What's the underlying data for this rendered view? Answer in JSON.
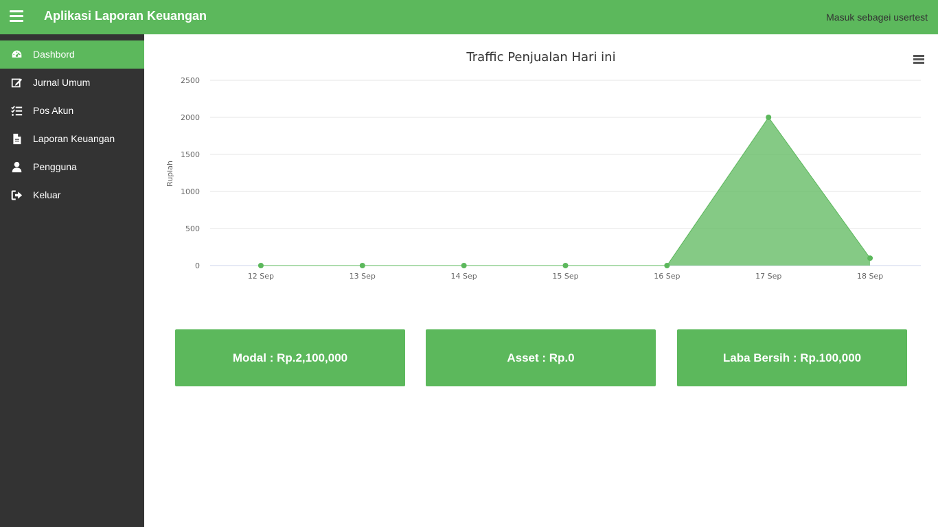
{
  "header": {
    "title": "Aplikasi Laporan Keuangan",
    "user_info": "Masuk sebagei usertest"
  },
  "sidebar": {
    "items": [
      {
        "label": "Dashbord",
        "icon": "dashboard-icon",
        "active": true
      },
      {
        "label": "Jurnal Umum",
        "icon": "edit-icon",
        "active": false
      },
      {
        "label": "Pos Akun",
        "icon": "tasks-icon",
        "active": false
      },
      {
        "label": "Laporan Keuangan",
        "icon": "file-icon",
        "active": false
      },
      {
        "label": "Pengguna",
        "icon": "user-icon",
        "active": false
      },
      {
        "label": "Keluar",
        "icon": "sign-out-icon",
        "active": false
      }
    ]
  },
  "chart_data": {
    "type": "area",
    "title": "Traffic Penjualan Hari ini",
    "xlabel": "",
    "ylabel": "Rupiah",
    "categories": [
      "12 Sep",
      "13 Sep",
      "14 Sep",
      "15 Sep",
      "16 Sep",
      "17 Sep",
      "18 Sep"
    ],
    "values": [
      0,
      0,
      0,
      0,
      0,
      2000,
      100
    ],
    "ylim": [
      0,
      2500
    ],
    "yticks": [
      0,
      500,
      1000,
      1500,
      2000,
      2500
    ],
    "grid": true,
    "legend": "none",
    "colors": {
      "line": "#5cb85c",
      "fill": "#5cb85c",
      "grid": "#e6e6e6",
      "axis_text": "#666666"
    }
  },
  "cards": [
    {
      "label": "Modal : Rp.2,100,000"
    },
    {
      "label": "Asset : Rp.0"
    },
    {
      "label": "Laba Bersih : Rp.100,000"
    }
  ],
  "colors": {
    "primary": "#5cb85c",
    "sidebar": "#333333"
  }
}
